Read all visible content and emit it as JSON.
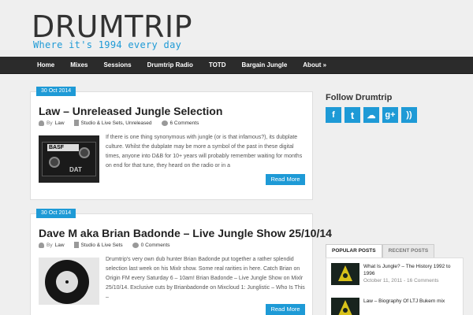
{
  "site": {
    "title": "DRUMTRIP",
    "tagline": "Where it's 1994 every day"
  },
  "nav": {
    "items": [
      "Home",
      "Mixes",
      "Sessions",
      "Drumtrip Radio",
      "TOTD",
      "Bargain Jungle",
      "About »"
    ]
  },
  "posts": [
    {
      "date": "30 Oct 2014",
      "title": "Law – Unreleased Jungle Selection",
      "by_label": "By",
      "author": "Law",
      "categories": "Studio & Live Sets, Unreleased",
      "comments": "6 Comments",
      "excerpt": "If there is one thing synonymous with jungle (or is that infamous?), its dubplate culture. Whilst the dubplate may be more a symbol of the past in these digital times, anyone into D&B for 10+ years will probably remember waiting for months on end for that tune, they heard on the radio or in a",
      "thumb_text_1": "BASF",
      "thumb_text_2": "DAT",
      "read_more": "Read More"
    },
    {
      "date": "30 Oct 2014",
      "title": "Dave M aka Brian Badonde – Live Jungle Show 25/10/14",
      "by_label": "By",
      "author": "Law",
      "categories": "Studio & Live Sets",
      "comments": "0 Comments",
      "excerpt": "Drumtrip's very own dub hunter Brian Badonde put together a rather splendid selection last week on his Mixlr show. Some real rarities in here. Catch Brian on Origin FM every Saturday 6 – 10am! Brian Badonde – Live Jungle Show on Mixlr 25/10/14. Exclusive cuts by Brianbadonde on Mixcloud 1: Junglistic – Who Is This –",
      "read_more": "Read More"
    }
  ],
  "sidebar": {
    "follow_title": "Follow Drumtrip",
    "social": [
      {
        "icon": "facebook-icon",
        "glyph": "f"
      },
      {
        "icon": "twitter-icon",
        "glyph": "t"
      },
      {
        "icon": "soundcloud-icon",
        "glyph": "☁"
      },
      {
        "icon": "googleplus-icon",
        "glyph": "g+"
      },
      {
        "icon": "rss-icon",
        "glyph": "))"
      }
    ],
    "tabs": [
      "POPULAR POSTS",
      "RECENT POSTS"
    ],
    "popular": [
      {
        "title": "What Is Jungle? – The History 1992 to 1996",
        "date": "October 11, 2011 - 16 Comments"
      },
      {
        "title": "Law – Biography Of LTJ Bukem mix",
        "date": ""
      }
    ]
  },
  "colors": {
    "accent": "#1e9ad6",
    "nav_bg": "#2b2b2b",
    "page_bg": "#efefef"
  }
}
